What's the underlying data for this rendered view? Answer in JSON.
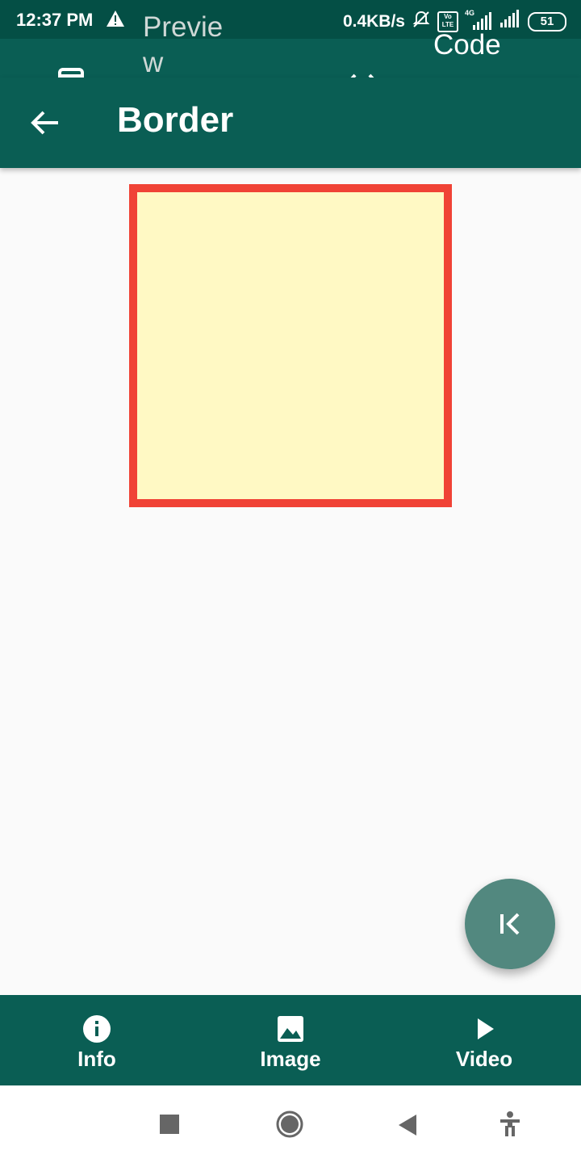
{
  "status_bar": {
    "time": "12:37 PM",
    "speed": "0.4KB/s",
    "battery": "51",
    "network": "4G",
    "volte": "Vo LTE"
  },
  "tabs": {
    "preview_label": "Preview",
    "code_label": "Code"
  },
  "app_bar": {
    "title": "Border"
  },
  "demo": {
    "fill_color": "#fff9c4",
    "border_color": "#f04336"
  },
  "bottom_nav": {
    "items": [
      {
        "label": "Info",
        "icon": "info-icon"
      },
      {
        "label": "Image",
        "icon": "image-icon"
      },
      {
        "label": "Video",
        "icon": "play-icon"
      }
    ]
  },
  "colors": {
    "primary": "#0a5e54",
    "status_bar": "#044f45",
    "fab": "#52887f"
  }
}
